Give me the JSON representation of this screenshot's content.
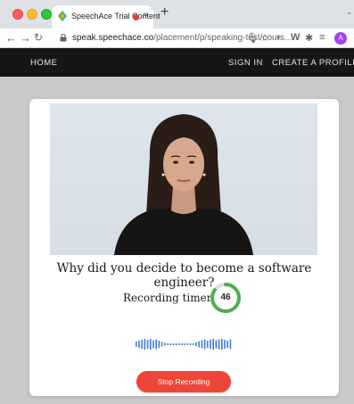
{
  "browser": {
    "tab_title": "SpeechAce Trial Content",
    "new_tab_icon": "+",
    "url_host": "speak.speechace.co",
    "url_path": "/placement/p/speaking-test/cours...",
    "profile_initial": "A"
  },
  "nav": {
    "home": "HOME",
    "sign_in": "SIGN IN",
    "create_profile": "CREATE A PROFILE"
  },
  "main": {
    "question": "Why did you decide to become a software engineer?",
    "timer_label": "Recording timer",
    "timer_value": "46",
    "timer_progress": 0.85,
    "stop_label": "Stop Recording"
  },
  "colors": {
    "accent_green": "#4caf50",
    "stop_red": "#ee4638",
    "nav_bg": "#161616",
    "wave_blue": "#3a7bd5"
  },
  "icons": [
    "back-icon",
    "forward-icon",
    "reload-icon",
    "lock-icon",
    "mic-icon",
    "star-icon",
    "extension-icon",
    "puzzle-icon",
    "menu-icon"
  ]
}
